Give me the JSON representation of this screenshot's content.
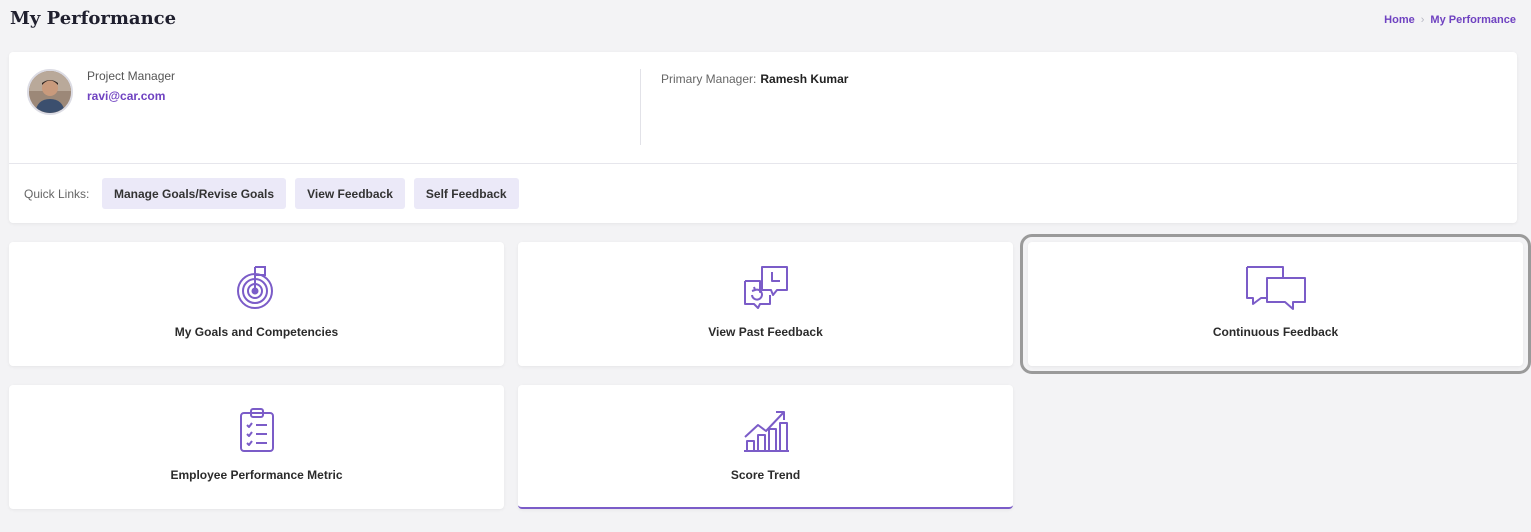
{
  "header": {
    "title": "My Performance",
    "breadcrumb": {
      "home": "Home",
      "separator": "›",
      "current": "My Performance"
    }
  },
  "profile": {
    "role": "Project Manager",
    "email": "ravi@car.com",
    "manager_label": "Primary Manager:",
    "manager_name": "Ramesh Kumar"
  },
  "quick_links": {
    "label": "Quick Links:",
    "items": [
      {
        "label": "Manage Goals/Revise Goals"
      },
      {
        "label": "View Feedback"
      },
      {
        "label": "Self Feedback"
      }
    ]
  },
  "tiles": [
    {
      "label": "My Goals and Competencies",
      "icon": "target-icon"
    },
    {
      "label": "View Past Feedback",
      "icon": "history-feedback-icon"
    },
    {
      "label": "Continuous Feedback",
      "icon": "chat-bubbles-icon"
    },
    {
      "label": "Employee Performance Metric",
      "icon": "clipboard-checklist-icon"
    },
    {
      "label": "Score Trend",
      "icon": "growth-chart-icon"
    }
  ],
  "colors": {
    "accent": "#6f42c1",
    "icon": "#7b5cc8",
    "chip_bg": "#ebe9f8",
    "page_bg": "#f3f3f5"
  }
}
